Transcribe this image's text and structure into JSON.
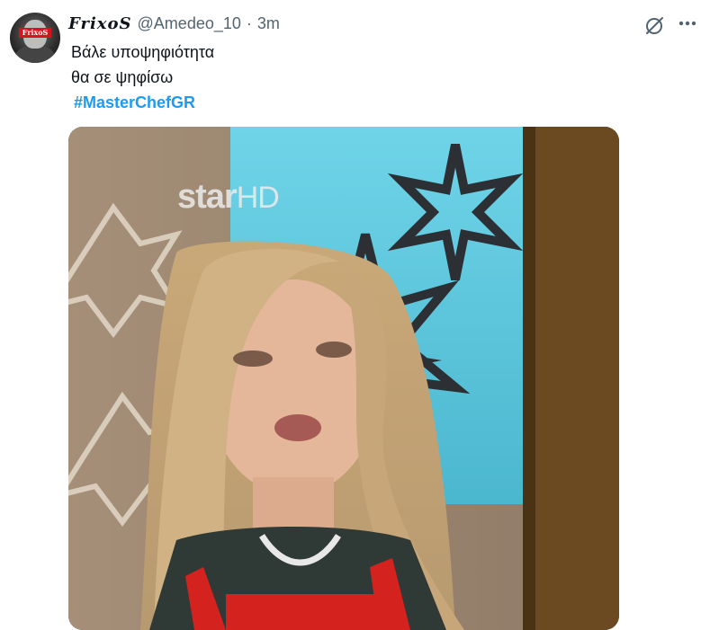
{
  "tweet": {
    "author": {
      "display_name": "FrixoS",
      "handle": "@Amedeo_10",
      "avatar_label": "FrixoS"
    },
    "separator": "·",
    "time": "3m",
    "text_lines": [
      "Βάλε υποψηφιότητα",
      "θα σε ψηφίσω"
    ],
    "hashtag": "#MasterChefGR",
    "media": {
      "watermark_main": "star",
      "watermark_hd": "HD"
    },
    "actions": {
      "grok_icon": "grok-slash-circle-icon",
      "more_icon": "more-dots-icon"
    }
  },
  "colors": {
    "accent": "#1d9bf0",
    "secondary_text": "#536471",
    "primary_text": "#0f1419"
  }
}
